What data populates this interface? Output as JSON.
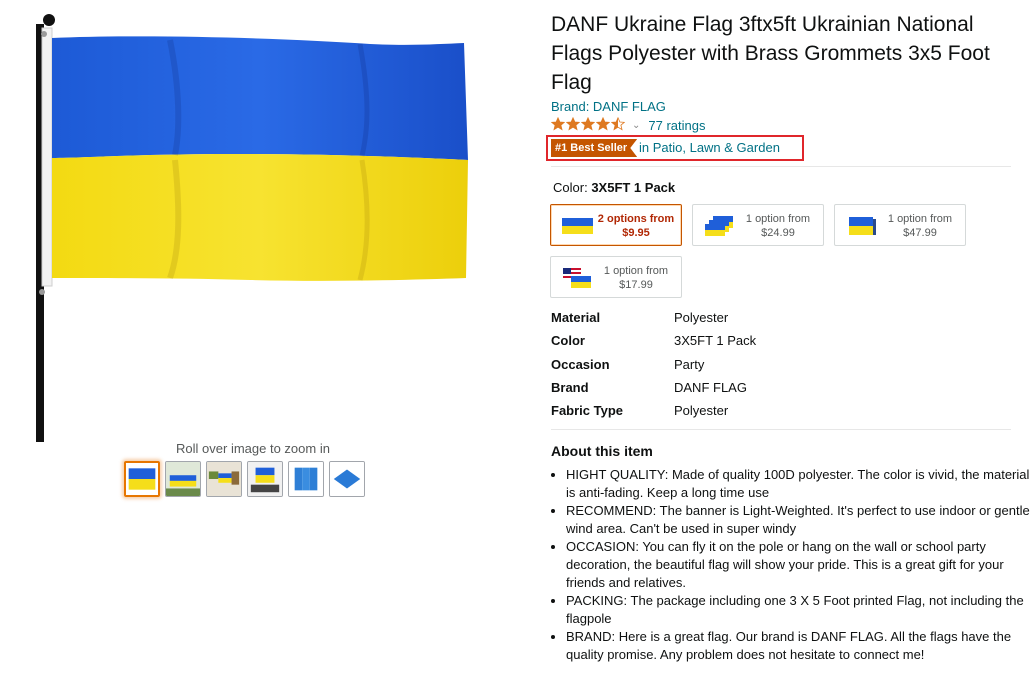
{
  "gallery": {
    "zoom_hint": "Roll over image to zoom in",
    "thumbnails": [
      "flag-thumb-icon",
      "flag-in-yard-thumb-icon",
      "flag-on-house-thumb-icon",
      "flag-on-table-thumb-icon",
      "flag-package-thumb-icon",
      "folded-flag-thumb-icon"
    ],
    "selected_index": 0
  },
  "product": {
    "title": "DANF Ukraine Flag 3ftx5ft Ukrainian National Flags Polyester with Brass Grommets 3x5 Foot Flag",
    "brand_link": "Brand: DANF FLAG",
    "rating_stars": 4.5,
    "ratings_count": "77 ratings",
    "best_seller_badge": "#1 Best Seller",
    "best_seller_category": "in Patio, Lawn & Garden"
  },
  "color": {
    "label": "Color:",
    "selected": "3X5FT 1 Pack",
    "swatches": [
      {
        "line1": "2 options from",
        "line2": "$9.95",
        "icon": "single-flag-icon",
        "selected": true
      },
      {
        "line1": "1 option from",
        "line2": "$24.99",
        "icon": "flag-stack-3-icon",
        "selected": false
      },
      {
        "line1": "1 option from",
        "line2": "$47.99",
        "icon": "flag-stack-5-icon",
        "selected": false
      },
      {
        "line1": "1 option from",
        "line2": "$17.99",
        "icon": "us-ukraine-flags-icon",
        "selected": false
      }
    ]
  },
  "specs": [
    {
      "key": "Material",
      "value": "Polyester"
    },
    {
      "key": "Color",
      "value": "3X5FT 1 Pack"
    },
    {
      "key": "Occasion",
      "value": "Party"
    },
    {
      "key": "Brand",
      "value": "DANF FLAG"
    },
    {
      "key": "Fabric Type",
      "value": "Polyester"
    }
  ],
  "about": {
    "title": "About this item",
    "bullets": [
      "HIGHT QUALITY: Made of quality 100D polyester. The color is vivid, the material is anti-fading. Keep a long time use",
      "RECOMMEND: The banner is Light-Weighted. It's perfect to use indoor or gentle wind area. Can't be used in super windy",
      "OCCASION: You can fly it on the pole or hang on the wall or school party decoration, the beautiful flag will show your pride. This is a great gift for your friends and relatives.",
      "PACKING: The package including one 3 X 5 Foot printed Flag, not including the flagpole",
      "BRAND: Here is a great flag. Our brand is DANF FLAG. All the flags have the quality promise. Any problem does not hesitate to connect me!"
    ]
  },
  "colors": {
    "flag_blue": "#1f5fd9",
    "flag_yellow": "#f5de1a",
    "link": "#007185",
    "badge": "#c45500",
    "highlight_box": "#e0262b"
  }
}
